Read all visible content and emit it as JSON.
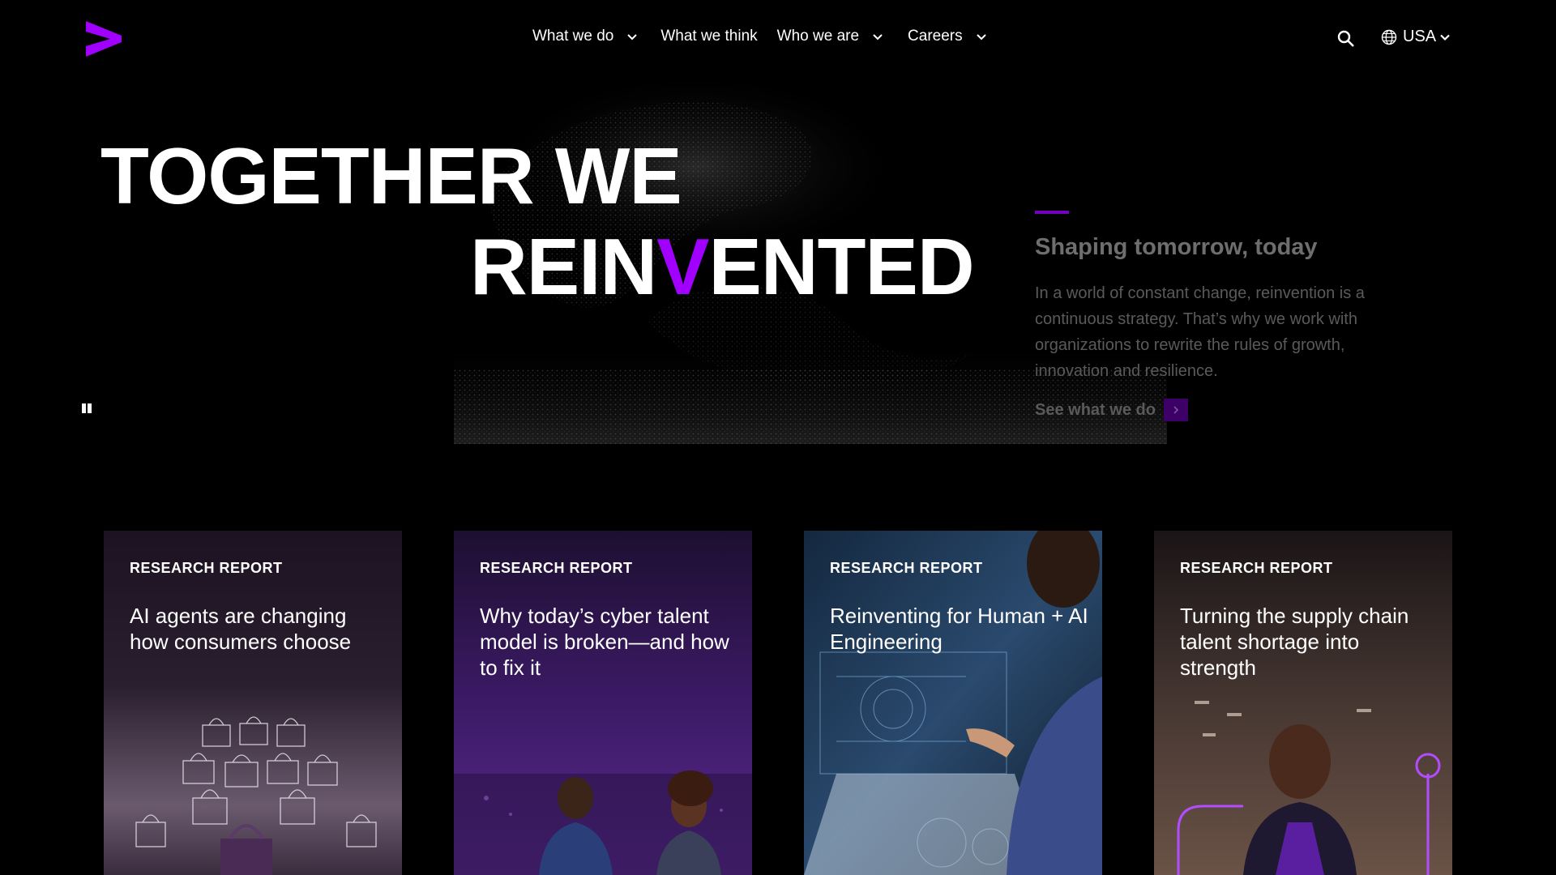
{
  "brand": {
    "logo": "accenture-greater-than-logo",
    "accent_color": "#a100ff"
  },
  "nav": {
    "items": [
      {
        "label": "What we do",
        "has_dropdown": true
      },
      {
        "label": "What we think",
        "has_dropdown": false
      },
      {
        "label": "Who we are",
        "has_dropdown": true
      },
      {
        "label": "Careers",
        "has_dropdown": true
      }
    ],
    "search_icon": "search-icon",
    "locale": {
      "icon": "globe-icon",
      "label": "USA"
    }
  },
  "hero": {
    "headline_line1": "TOGETHER WE",
    "headline_line2_before": "REIN",
    "headline_line2_accent": "V",
    "headline_line2_after": "ENTED",
    "subheading": "Shaping tomorrow, today",
    "body": "In a world of constant change, reinvention is a continuous strategy. That’s why we work with organizations to rewrite the rules of growth, innovation and resilience.",
    "cta_label": "See what we do",
    "pause_icon": "pause-icon"
  },
  "cards": [
    {
      "tag": "RESEARCH REPORT",
      "title": "AI agents are changing how consumers choose"
    },
    {
      "tag": "RESEARCH REPORT",
      "title": "Why today’s cyber talent model is broken—and how to fix it"
    },
    {
      "tag": "RESEARCH REPORT",
      "title": "Reinventing for Human + AI Engineering"
    },
    {
      "tag": "RESEARCH REPORT",
      "title": "Turning the supply chain talent shortage into strength"
    }
  ]
}
